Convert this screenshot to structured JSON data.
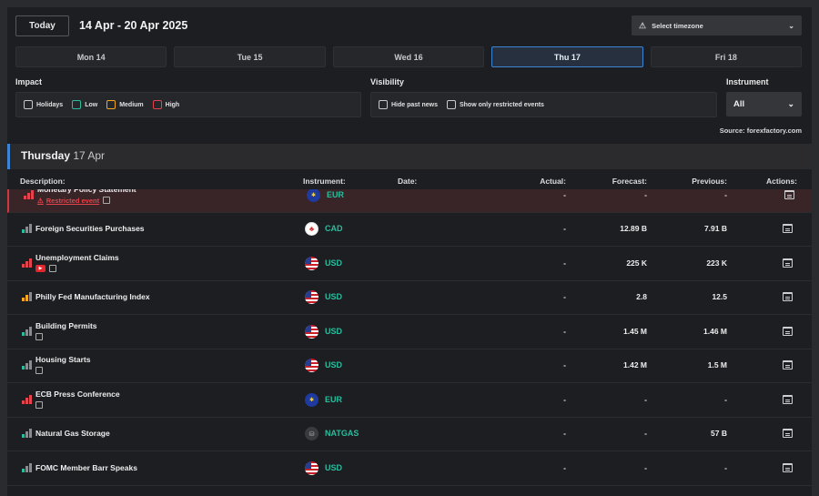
{
  "header": {
    "today_label": "Today",
    "date_range": "14 Apr - 20 Apr 2025",
    "timezone_label": "Select timezone",
    "timezone_icon": "globe-warning-icon"
  },
  "days": [
    "Mon 14",
    "Tue 15",
    "Wed 16",
    "Thu 17",
    "Fri 18"
  ],
  "active_day": "Thu 17",
  "filters": {
    "impact_label": "Impact",
    "impact": [
      "Holidays",
      "Low",
      "Medium",
      "High"
    ],
    "visibility_label": "Visibility",
    "visibility": [
      "Hide past news",
      "Show only restricted events"
    ],
    "instrument_label": "Instrument",
    "instrument_value": "All"
  },
  "source": "Source: forexfactory.com",
  "day_header": {
    "weekday": "Thursday",
    "date": "17 Apr"
  },
  "columns": {
    "description": "Description:",
    "instrument": "Instrument:",
    "date": "Date:",
    "actual": "Actual:",
    "forecast": "Forecast:",
    "previous": "Previous:",
    "actions": "Actions:"
  },
  "colors": {
    "high": "#e2434c",
    "medium": "#f5a623",
    "low": "#2bbd9e",
    "accent": "#3b84d6"
  },
  "events": [
    {
      "name": "Monetary Policy Statement",
      "impact": "high",
      "currency": "EUR",
      "flag": "eur",
      "actual": "-",
      "forecast": "-",
      "previous": "-",
      "restricted": true,
      "restricted_label": "Restricted event"
    },
    {
      "name": "Foreign Securities Purchases",
      "impact": "low",
      "currency": "CAD",
      "flag": "cad",
      "actual": "-",
      "forecast": "12.89 B",
      "previous": "7.91 B"
    },
    {
      "name": "Unemployment Claims",
      "impact": "high",
      "currency": "USD",
      "flag": "usd",
      "actual": "-",
      "forecast": "225 K",
      "previous": "223 K",
      "video": true,
      "note": true
    },
    {
      "name": "Philly Fed Manufacturing Index",
      "impact": "medium",
      "currency": "USD",
      "flag": "usd",
      "actual": "-",
      "forecast": "2.8",
      "previous": "12.5"
    },
    {
      "name": "Building Permits",
      "impact": "low",
      "currency": "USD",
      "flag": "usd",
      "actual": "-",
      "forecast": "1.45 M",
      "previous": "1.46 M",
      "note": true
    },
    {
      "name": "Housing Starts",
      "impact": "low",
      "currency": "USD",
      "flag": "usd",
      "actual": "-",
      "forecast": "1.42 M",
      "previous": "1.5 M",
      "note": true
    },
    {
      "name": "ECB Press Conference",
      "impact": "high",
      "currency": "EUR",
      "flag": "eur",
      "actual": "-",
      "forecast": "-",
      "previous": "-",
      "note": true
    },
    {
      "name": "Natural Gas Storage",
      "impact": "low",
      "currency": "NATGAS",
      "flag": "gas",
      "actual": "-",
      "forecast": "-",
      "previous": "57 B"
    },
    {
      "name": "FOMC Member Barr Speaks",
      "impact": "low",
      "currency": "USD",
      "flag": "usd",
      "actual": "-",
      "forecast": "-",
      "previous": "-"
    }
  ]
}
